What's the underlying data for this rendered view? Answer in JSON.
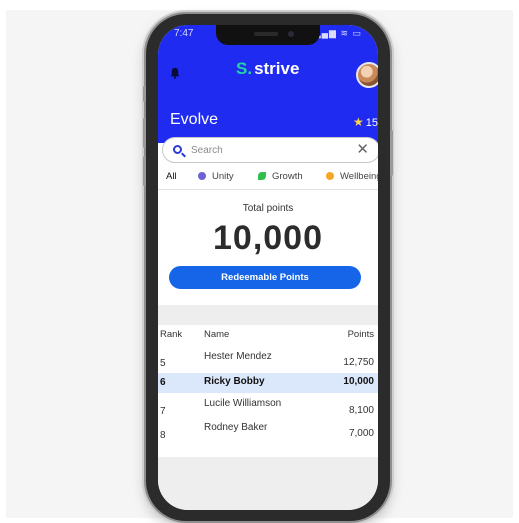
{
  "status_bar": {
    "time": "7:47",
    "icons": "▂▄▆ ≋ ▭"
  },
  "header": {
    "logo_mark": "S.",
    "logo_text": "strive",
    "title": "Evolve",
    "badge_value": "15",
    "star_icon": "★"
  },
  "search": {
    "placeholder": "Search",
    "value": "",
    "clear_icon": "✕"
  },
  "tabs": [
    {
      "label": "All",
      "active": true
    },
    {
      "label": "Unity",
      "icon": "unity-globe-icon",
      "color": "#6e63d6"
    },
    {
      "label": "Growth",
      "icon": "growth-leaf-icon",
      "color": "#2fbf4a"
    },
    {
      "label": "Wellbeing",
      "icon": "wellbeing-icon",
      "color": "#f5a623"
    }
  ],
  "points": {
    "label": "Total points",
    "value": "10,000",
    "button_label": "Redeemable Points"
  },
  "leaderboard": {
    "columns": {
      "rank": "Rank",
      "name": "Name",
      "points": "Points"
    },
    "rows": [
      {
        "rank": "5",
        "name": "Hester Mendez",
        "points": "12,750"
      },
      {
        "rank": "6",
        "name": "Ricky Bobby",
        "points": "10,000",
        "highlight": true
      },
      {
        "rank": "7",
        "name": "Lucile Williamson",
        "points": "8,100"
      },
      {
        "rank": "8",
        "name": "Rodney Baker",
        "points": "7,000"
      }
    ]
  },
  "colors": {
    "header_bg": "#1f2bf0",
    "button_bg": "#1665e8",
    "logo_accent": "#25d3a4",
    "highlight_row": "#dbe7fb"
  }
}
